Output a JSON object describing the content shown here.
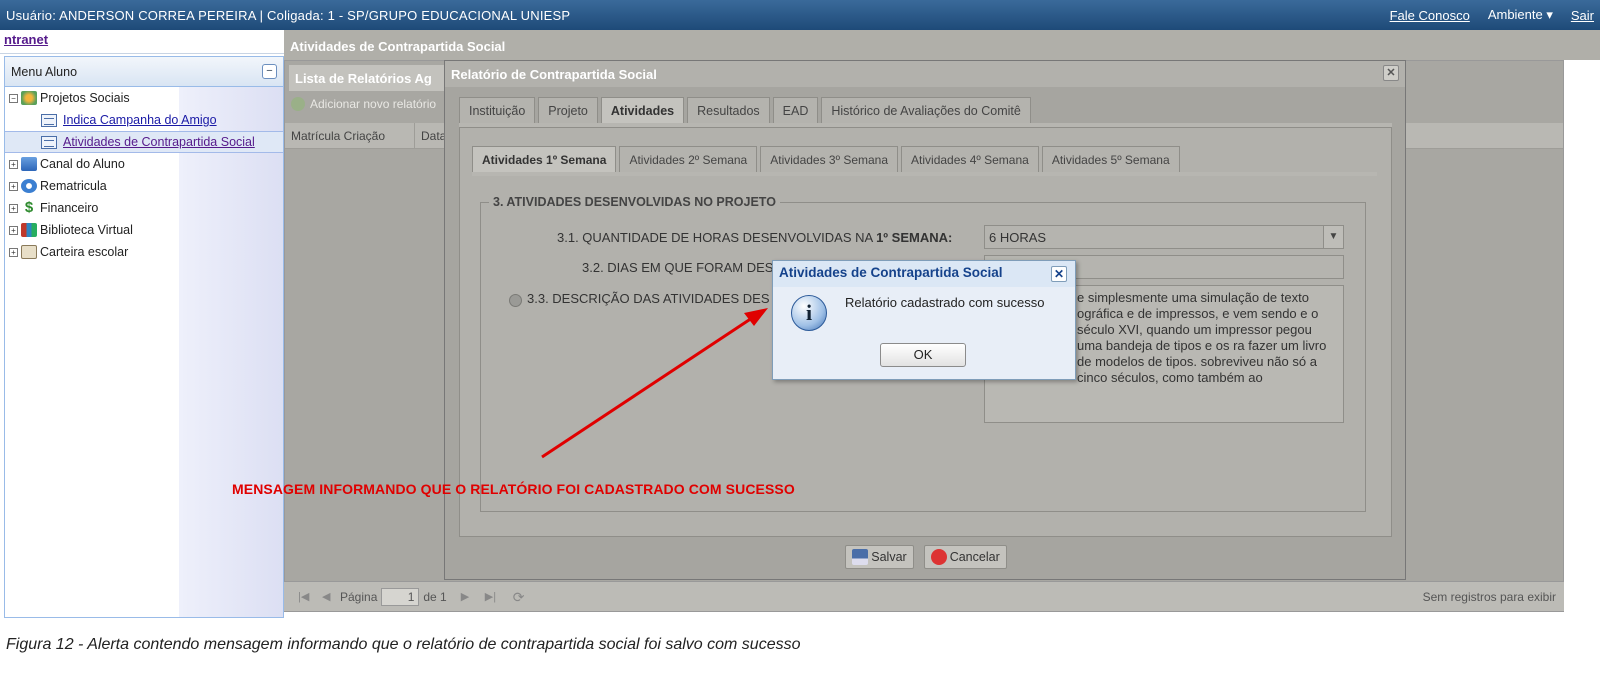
{
  "topbar": {
    "user_info": "Usuário: ANDERSON CORREA PEREIRA  |  Coligada: 1 - SP/GRUPO EDUCACIONAL UNIESP",
    "contact": "Fale Conosco",
    "environment": "Ambiente ▾",
    "logout": "Sair"
  },
  "sidebar": {
    "intranet": "ntranet",
    "menu_title": "Menu Aluno",
    "items": [
      {
        "label": "Projetos Sociais",
        "icon": "social-projects-icon"
      },
      {
        "label": "Indica Campanha do Amigo",
        "icon": "document-icon"
      },
      {
        "label": "Atividades de Contrapartida Social",
        "icon": "document-icon"
      },
      {
        "label": "Canal do Aluno",
        "icon": "mail-icon"
      },
      {
        "label": "Rematricula",
        "icon": "refresh-icon"
      },
      {
        "label": "Financeiro",
        "icon": "dollar-icon"
      },
      {
        "label": "Biblioteca Virtual",
        "icon": "books-icon"
      },
      {
        "label": "Carteira escolar",
        "icon": "id-card-icon"
      }
    ]
  },
  "main": {
    "title": "Atividades de Contrapartida Social",
    "list_title": "Lista de Relatórios Ag",
    "add_new": "Adicionar novo relatório",
    "columns": [
      "Matrícula Criação",
      "Data"
    ],
    "pager": {
      "page_label": "Página",
      "page_value": "1",
      "of_label": "de 1",
      "no_records": "Sem registros para exibir"
    }
  },
  "modal": {
    "title": "Relatório de Contrapartida Social",
    "tabs": [
      "Instituição",
      "Projeto",
      "Atividades",
      "Resultados",
      "EAD",
      "Histórico de Avaliações do Comitê"
    ],
    "subtabs": [
      "Atividades 1º Semana",
      "Atividades 2º Semana",
      "Atividades 3º Semana",
      "Atividades 4º Semana",
      "Atividades 5º Semana"
    ],
    "section_title": "3. ATIVIDADES DESENVOLVIDAS NO PROJETO",
    "hours_label": "3.1. QUANTIDADE DE HORAS DESENVOLVIDAS NA",
    "hours_label_bold": "1º SEMANA:",
    "hours_value": "6 HORAS",
    "days_label": "3.2. DIAS EM QUE FORAM DES",
    "description_label": "3.3. DESCRIÇÃO DAS ATIVIDADES DES",
    "description_text": "e simplesmente uma simulação de texto ográfica e de impressos, e vem sendo e o século XVI, quando um impressor pegou uma bandeja de tipos e os ra fazer um livro de modelos de tipos. sobreviveu não só a cinco séculos, como também ao",
    "save_label": "Salvar",
    "cancel_label": "Cancelar"
  },
  "alert": {
    "title": "Atividades de Contrapartida Social",
    "message": "Relatório cadastrado com sucesso",
    "ok_label": "OK"
  },
  "annotation": "MENSAGEM INFORMANDO QUE O RELATÓRIO FOI CADASTRADO COM SUCESSO",
  "caption": "Figura 12 - Alerta contendo mensagem informando que o relatório de contrapartida social foi salvo com sucesso",
  "colors": {
    "topbar": "#1e4a78",
    "annotation_red": "#e00000",
    "alert_title": "#15428b"
  }
}
